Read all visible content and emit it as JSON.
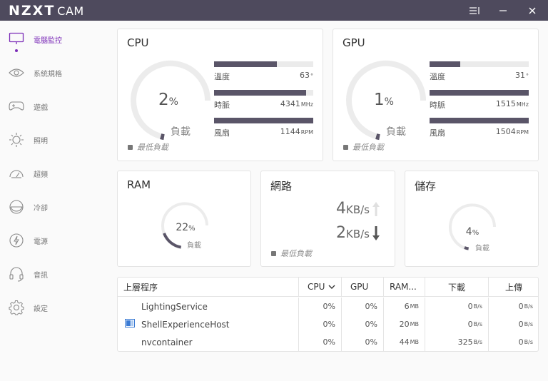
{
  "app": {
    "logo_main": "NZXT",
    "logo_sub": "CAM",
    "accent_color": "#7c2db8",
    "titlebar_color": "#4e4a5d"
  },
  "titlebar": {
    "menu_icon": "menu-icon",
    "minimize_icon": "minimize-icon",
    "close_icon": "close-icon"
  },
  "sidebar": {
    "items": [
      {
        "label": "電腦監控",
        "icon": "monitor-icon",
        "active": true
      },
      {
        "label": "系統規格",
        "icon": "eye-icon",
        "active": false
      },
      {
        "label": "遊戲",
        "icon": "gamepad-icon",
        "active": false
      },
      {
        "label": "照明",
        "icon": "light-icon",
        "active": false
      },
      {
        "label": "超頻",
        "icon": "speedometer-icon",
        "active": false
      },
      {
        "label": "冷卻",
        "icon": "cooling-icon",
        "active": false
      },
      {
        "label": "電源",
        "icon": "power-icon",
        "active": false
      },
      {
        "label": "音訊",
        "icon": "headset-icon",
        "active": false
      },
      {
        "label": "設定",
        "icon": "gear-icon",
        "active": false
      }
    ]
  },
  "cpu": {
    "title": "CPU",
    "load_value": "2",
    "load_unit": "%",
    "load_fraction": 0.02,
    "load_label": "負載",
    "low_load_label": "最低負載",
    "temp": {
      "label": "溫度",
      "value": "63",
      "unit": "°",
      "fraction": 0.63
    },
    "clock": {
      "label": "時脈",
      "value": "4341",
      "unit": "MHz",
      "fraction": 0.93
    },
    "fan": {
      "label": "風扇",
      "value": "1144",
      "unit": "RPM",
      "fraction": 1.0
    }
  },
  "gpu": {
    "title": "GPU",
    "load_value": "1",
    "load_unit": "%",
    "load_fraction": 0.01,
    "load_label": "負載",
    "low_load_label": "最低負載",
    "temp": {
      "label": "溫度",
      "value": "31",
      "unit": "°",
      "fraction": 0.31
    },
    "clock": {
      "label": "時脈",
      "value": "1515",
      "unit": "MHz",
      "fraction": 1.0
    },
    "fan": {
      "label": "風扇",
      "value": "1504",
      "unit": "RPM",
      "fraction": 1.0
    }
  },
  "ram": {
    "title": "RAM",
    "load_value": "22",
    "load_unit": "%",
    "load_fraction": 0.22,
    "load_label": "負載"
  },
  "network": {
    "title": "網路",
    "up_value": "4",
    "up_unit": "KB/s",
    "down_value": "2",
    "down_unit": "KB/s",
    "low_load_label": "最低負載"
  },
  "storage": {
    "title": "儲存",
    "load_value": "4",
    "load_unit": "%",
    "load_fraction": 0.04,
    "load_label": "負載"
  },
  "table": {
    "headers": {
      "process": "上層程序",
      "cpu": "CPU",
      "gpu": "GPU",
      "ram": "RAM...",
      "download": "下載",
      "upload": "上傳"
    },
    "rows": [
      {
        "name": "LightingService",
        "cpu": "0%",
        "gpu": "0%",
        "ram": "6",
        "ram_unit": "MB",
        "down": "0",
        "down_unit": "B/s",
        "up": "0",
        "up_unit": "B/s",
        "has_icon": false
      },
      {
        "name": "ShellExperienceHost",
        "cpu": "0%",
        "gpu": "0%",
        "ram": "20",
        "ram_unit": "MB",
        "down": "0",
        "down_unit": "B/s",
        "up": "0",
        "up_unit": "B/s",
        "has_icon": true
      },
      {
        "name": "nvcontainer",
        "cpu": "0%",
        "gpu": "0%",
        "ram": "44",
        "ram_unit": "MB",
        "down": "325",
        "down_unit": "B/s",
        "up": "0",
        "up_unit": "B/s",
        "has_icon": false
      }
    ]
  }
}
